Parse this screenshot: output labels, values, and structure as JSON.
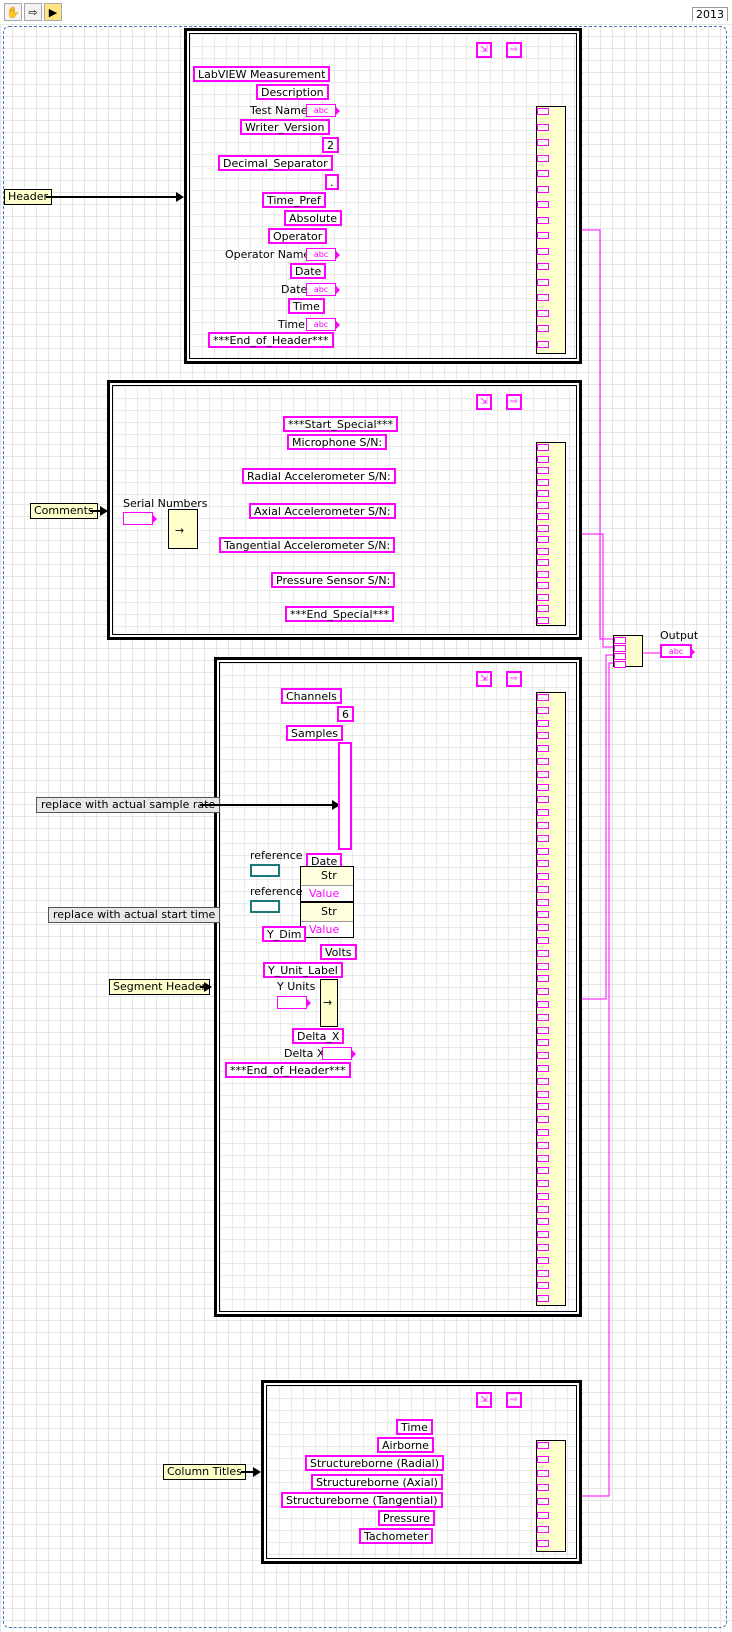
{
  "toolbar": {
    "version": "2013"
  },
  "header_section": {
    "input_label": "Header",
    "constants": [
      "LabVIEW Measurement",
      "Description",
      "Writer_Version",
      "2",
      "Decimal_Separator",
      ".",
      "Time_Pref",
      "Absolute",
      "Operator",
      "Date",
      "Time",
      "***End_of_Header***"
    ],
    "labels": [
      "Test Name",
      "Operator Name",
      "Date",
      "Time"
    ],
    "indicator_text": "abc"
  },
  "comments_section": {
    "input_label": "Comments",
    "serial_label": "Serial Numbers",
    "constants": [
      "***Start_Special***",
      "Microphone S/N:",
      "Radial Accelerometer S/N:",
      "Axial Accelerometer S/N:",
      "Tangential Accelerometer S/N:",
      "Pressure Sensor S/N:",
      "***End_Special***"
    ]
  },
  "segment_section": {
    "input_label": "Segment Header",
    "comment_sample_rate": "replace with actual sample rate",
    "comment_start_time": "replace with actual start time",
    "constants": [
      "Channels",
      "6",
      "Samples",
      "Date",
      "Y_Dim",
      "Volts",
      "Y_Unit_Label",
      "Delta_X",
      "***End_of_Header***"
    ],
    "reference_label": "reference",
    "ref_str": "Str",
    "ref_value": "Value",
    "y_units_label": "Y Units",
    "delta_x_label": "Delta X"
  },
  "columns_section": {
    "input_label": "Column Titles",
    "constants": [
      "Time",
      "Airborne",
      "Structureborne (Radial)",
      "Structureborne (Axial)",
      "Structureborne (Tangential)",
      "Pressure",
      "Tachometer"
    ]
  },
  "output": {
    "label": "Output"
  }
}
